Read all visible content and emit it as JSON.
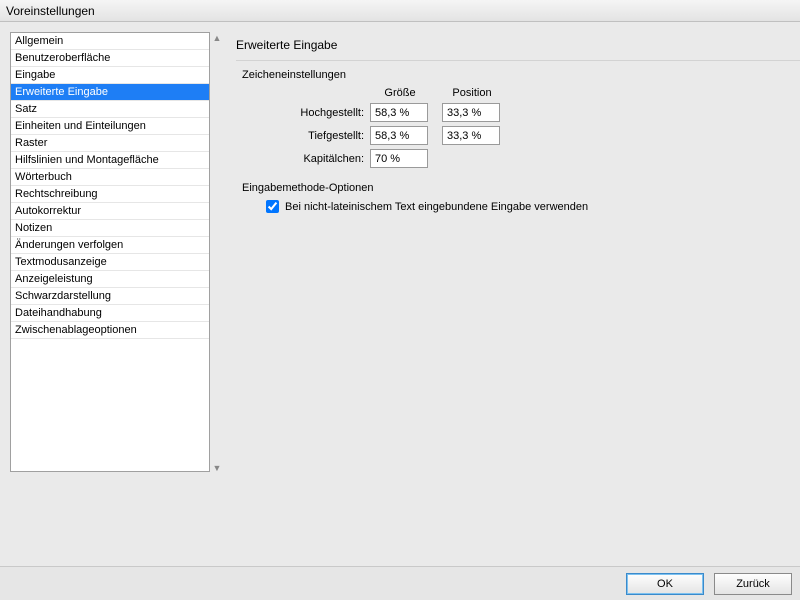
{
  "window": {
    "title": "Voreinstellungen"
  },
  "sidebar": {
    "items": [
      "Allgemein",
      "Benutzeroberfläche",
      "Eingabe",
      "Erweiterte Eingabe",
      "Satz",
      "Einheiten und Einteilungen",
      "Raster",
      "Hilfslinien und Montagefläche",
      "Wörterbuch",
      "Rechtschreibung",
      "Autokorrektur",
      "Notizen",
      "Änderungen verfolgen",
      "Textmodusanzeige",
      "Anzeigeleistung",
      "Schwarzdarstellung",
      "Dateihandhabung",
      "Zwischenablageoptionen"
    ],
    "selected_index": 3
  },
  "panel": {
    "title": "Erweiterte Eingabe",
    "char_group": {
      "title": "Zeicheneinstellungen",
      "col_size": "Größe",
      "col_position": "Position",
      "rows": {
        "superscript": {
          "label": "Hochgestellt:",
          "size": "58,3 %",
          "position": "33,3 %"
        },
        "subscript": {
          "label": "Tiefgestellt:",
          "size": "58,3 %",
          "position": "33,3 %"
        },
        "smallcaps": {
          "label": "Kapitälchen:",
          "size": "70 %"
        }
      }
    },
    "ime_group": {
      "title": "Eingabemethode-Optionen",
      "inline_input": {
        "label": "Bei nicht-lateinischem Text eingebundene Eingabe verwenden",
        "checked": true
      }
    }
  },
  "footer": {
    "ok": "OK",
    "back": "Zurück"
  }
}
